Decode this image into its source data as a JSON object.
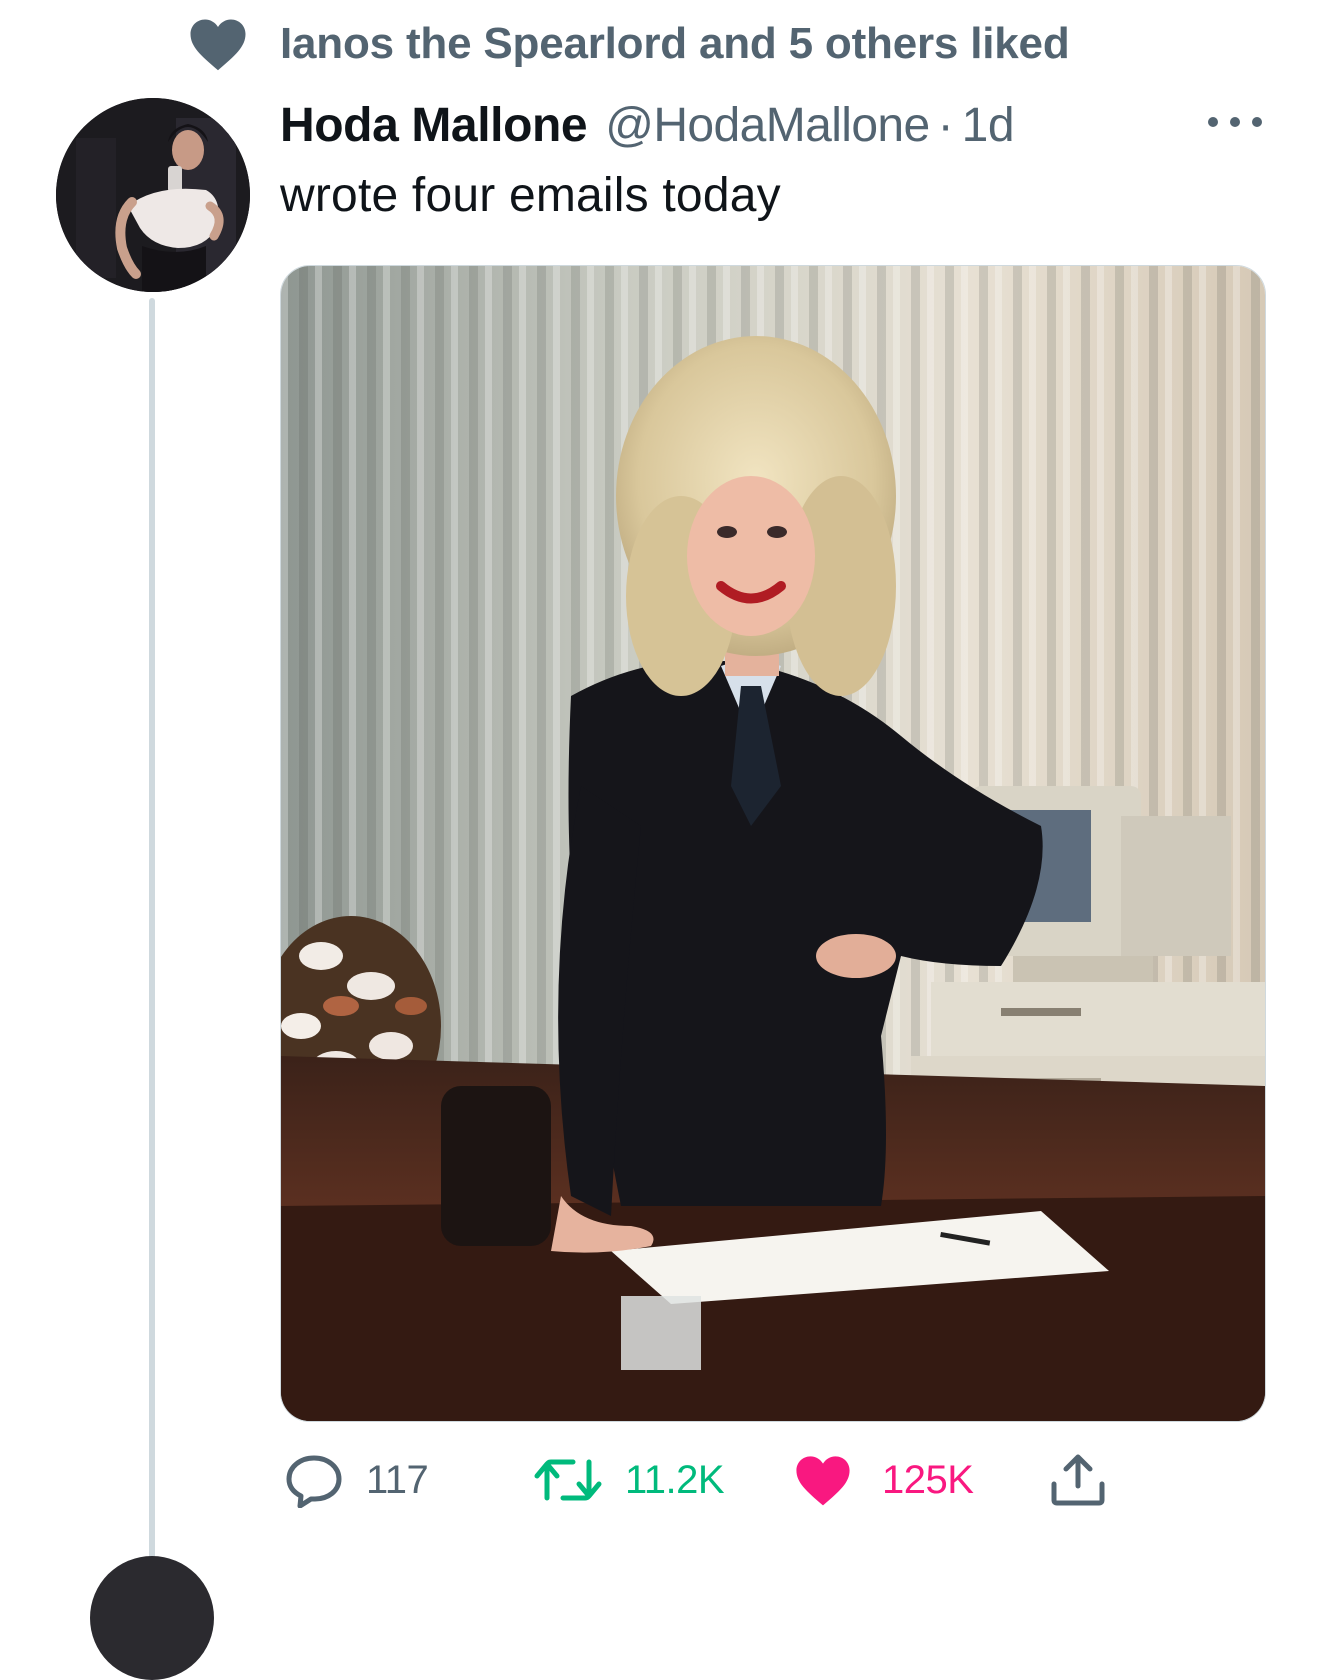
{
  "social_context": {
    "text": "Ianos the Spearlord and 5 others liked",
    "icon": "heart-icon"
  },
  "tweet": {
    "author": {
      "display_name": "Hoda Mallone",
      "handle": "@HodaMallone",
      "avatar": "profile-photo"
    },
    "separator": "·",
    "timestamp": "1d",
    "text": "wrote four emails today",
    "media": {
      "type": "photo",
      "description_icon": "photo"
    },
    "actions": {
      "reply": {
        "icon": "reply-bubble-icon",
        "count": "117"
      },
      "retweet": {
        "icon": "retweet-icon",
        "count": "11.2K",
        "color": "#00ba7c"
      },
      "like": {
        "icon": "heart-filled-icon",
        "count": "125K",
        "color": "#f91880"
      },
      "share": {
        "icon": "share-upload-icon"
      }
    }
  },
  "colors": {
    "secondary_text": "#536471",
    "primary_text": "#0f1419",
    "thread_line": "#cfd9de"
  }
}
